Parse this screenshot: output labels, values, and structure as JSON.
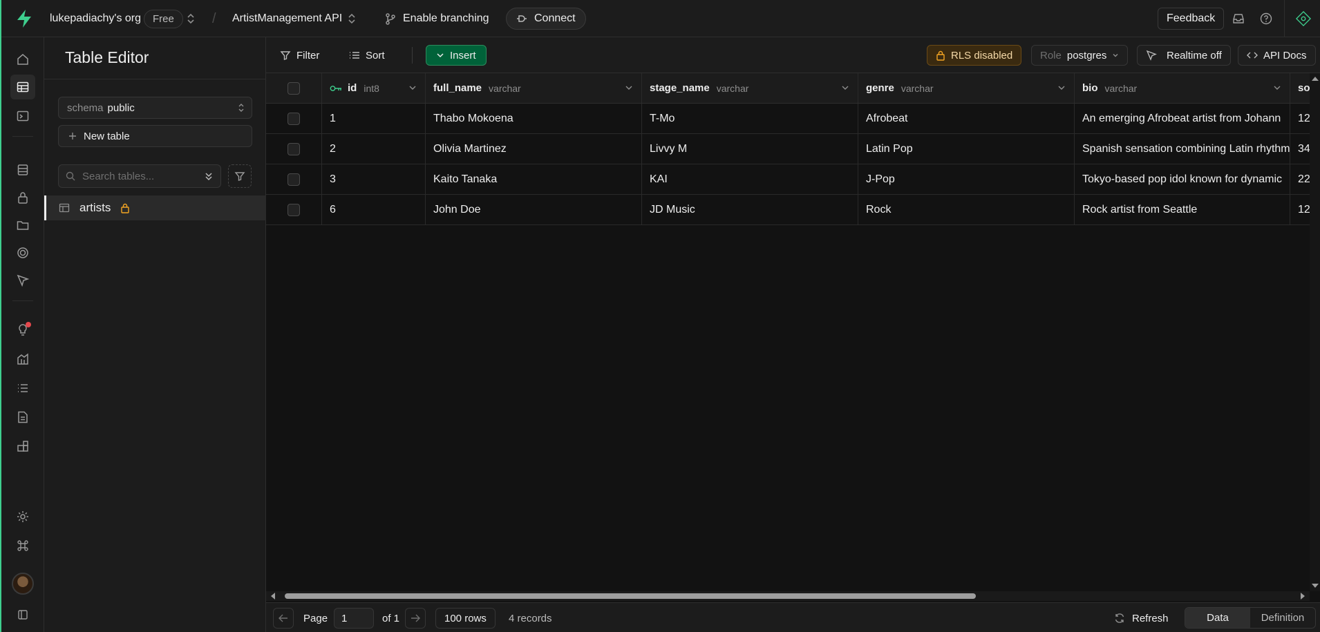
{
  "topbar": {
    "org": "lukepadiachy's org",
    "plan": "Free",
    "project": "ArtistManagement API",
    "branching": "Enable branching",
    "connect": "Connect",
    "feedback": "Feedback"
  },
  "sidebar": {
    "title": "Table Editor",
    "schema_label": "schema",
    "schema_value": "public",
    "new_table": "New table",
    "search_placeholder": "Search tables...",
    "tables": [
      {
        "name": "artists"
      }
    ]
  },
  "toolbar": {
    "filter": "Filter",
    "sort": "Sort",
    "insert": "Insert",
    "rls": "RLS disabled",
    "role_label": "Role",
    "role_value": "postgres",
    "realtime": "Realtime off",
    "api_docs": "API Docs"
  },
  "grid": {
    "columns": [
      {
        "name": "id",
        "type": "int8"
      },
      {
        "name": "full_name",
        "type": "varchar"
      },
      {
        "name": "stage_name",
        "type": "varchar"
      },
      {
        "name": "genre",
        "type": "varchar"
      },
      {
        "name": "bio",
        "type": "varchar"
      },
      {
        "name": "so",
        "type": ""
      }
    ],
    "rows": [
      [
        "1",
        "Thabo Mokoena",
        "T-Mo",
        "Afrobeat",
        "An emerging Afrobeat artist from Johann",
        "12"
      ],
      [
        "2",
        "Olivia Martinez",
        "Livvy M",
        "Latin Pop",
        "Spanish sensation combining Latin rhythm",
        "34"
      ],
      [
        "3",
        "Kaito Tanaka",
        "KAI",
        "J-Pop",
        "Tokyo-based pop idol known for dynamic",
        "22"
      ],
      [
        "6",
        "John Doe",
        "JD Music",
        "Rock",
        "Rock artist from Seattle",
        "12"
      ]
    ]
  },
  "footer": {
    "page_label": "Page",
    "page_value": "1",
    "of_pages": "of 1",
    "rows_per_page": "100 rows",
    "records": "4 records",
    "refresh": "Refresh",
    "tab_data": "Data",
    "tab_definition": "Definition"
  },
  "colors": {
    "accent": "#3ecf8e",
    "insert": "#006239",
    "warning": "#f5a623",
    "notification": "#e5484d"
  }
}
